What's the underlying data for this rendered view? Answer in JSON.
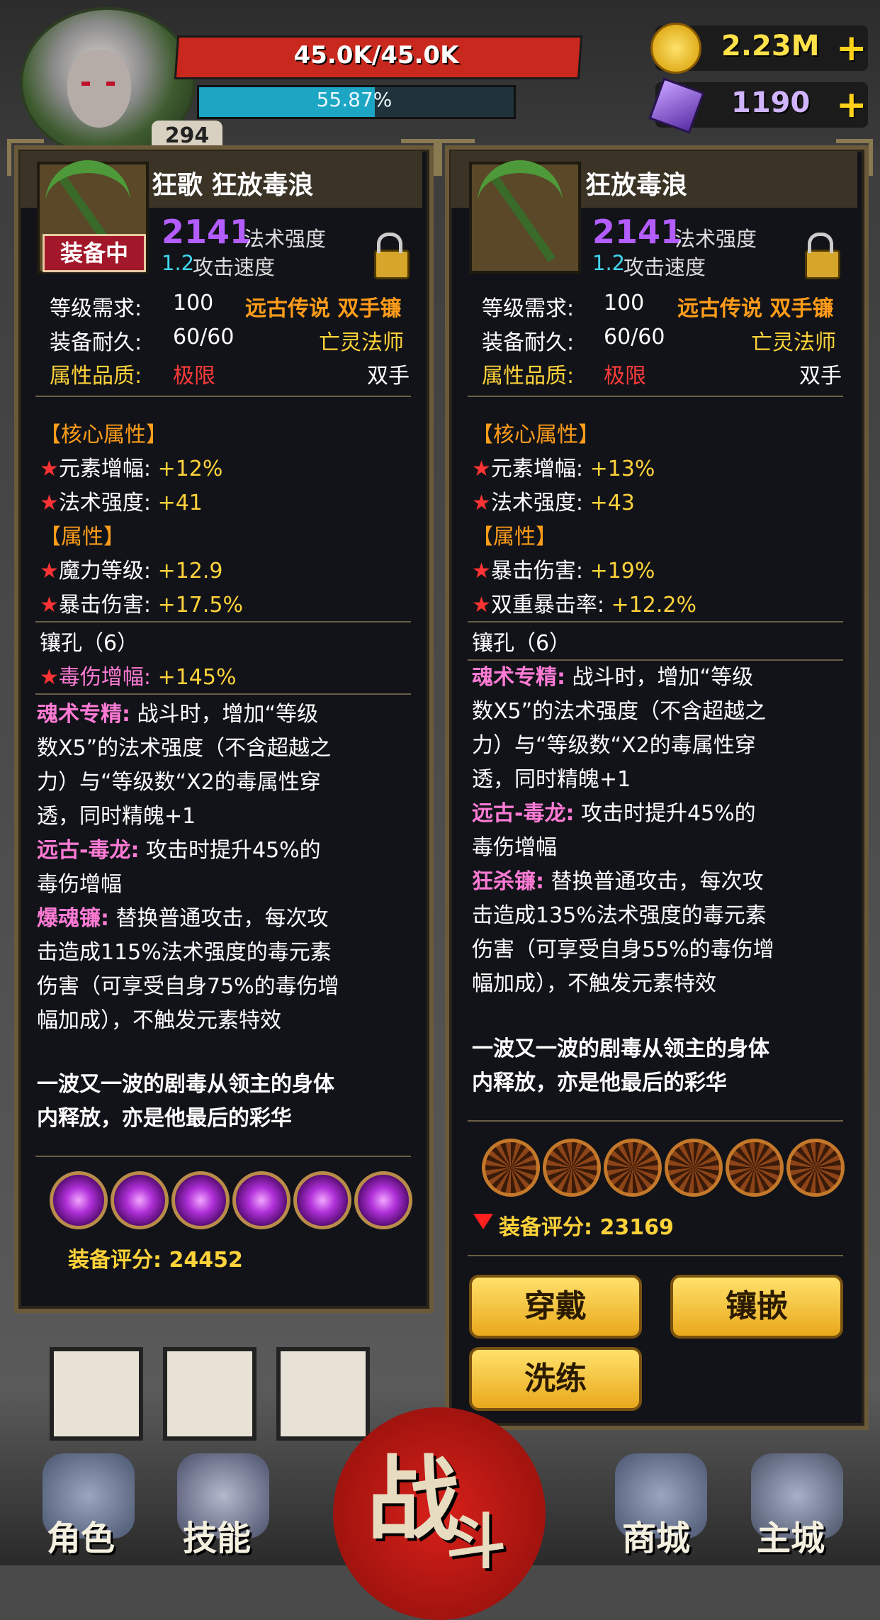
{
  "hud": {
    "hp_text": "45.0K/45.0K",
    "hp_fraction": 1.0,
    "xp_text": "55.87%",
    "xp_fraction": 0.5587,
    "level": "294",
    "gold": "2.23M",
    "gems": "1190",
    "plus": "+"
  },
  "left": {
    "title": "狂歌 狂放毒浪",
    "power": "2141",
    "power_label": "法术强度",
    "speed": "1.2",
    "speed_label": "攻击速度",
    "equipped_badge": "装备中",
    "req_label": "等级需求:",
    "req_value": "100",
    "type": "远古传说 双手镰",
    "dur_label": "装备耐久:",
    "dur_value": "60/60",
    "class": "亡灵法师",
    "quality_label": "属性品质:",
    "quality_value": "极限",
    "hand": "双手",
    "core_section": "【核心属性】",
    "core": [
      {
        "name": "元素增幅:",
        "value": "+12%"
      },
      {
        "name": "法术强度:",
        "value": "+41"
      }
    ],
    "attr_section": "【属性】",
    "attrs": [
      {
        "name": "魔力等级:",
        "value": "+12.9"
      },
      {
        "name": "暴击伤害:",
        "value": "+17.5%"
      }
    ],
    "sockets_label": "镶孔（6）",
    "socket_bonus_name": "毒伤增幅:",
    "socket_bonus_value": "+145%",
    "skill1_name": "魂术专精:",
    "skill1_lines": [
      "战斗时，增加“等级",
      "数X5”的法术强度（不含超越之",
      "力）与“等级数“X2的毒属性穿",
      "透，同时精魄+1"
    ],
    "skill2_name": "远古-毒龙:",
    "skill2_lines": [
      "攻击时提升45%的",
      "毒伤增幅"
    ],
    "skill3_name": "爆魂镰:",
    "skill3_lines": [
      "替换普通攻击，每次攻",
      "击造成115%法术强度的毒元素",
      "伤害（可享受自身75%的毒伤增",
      "幅加成），不触发元素特效"
    ],
    "flavor_lines": [
      "一波又一波的剧毒从领主的身体",
      "内释放，亦是他最后的彩华"
    ],
    "score_label": "装备评分:",
    "score": "24452"
  },
  "right": {
    "title": "狂放毒浪",
    "power": "2141",
    "power_label": "法术强度",
    "speed": "1.2",
    "speed_label": "攻击速度",
    "req_label": "等级需求:",
    "req_value": "100",
    "type": "远古传说 双手镰",
    "dur_label": "装备耐久:",
    "dur_value": "60/60",
    "class": "亡灵法师",
    "quality_label": "属性品质:",
    "quality_value": "极限",
    "hand": "双手",
    "core_section": "【核心属性】",
    "core": [
      {
        "name": "元素增幅:",
        "value": "+13%"
      },
      {
        "name": "法术强度:",
        "value": "+43"
      }
    ],
    "attr_section": "【属性】",
    "attrs": [
      {
        "name": "暴击伤害:",
        "value": "+19%"
      },
      {
        "name": "双重暴击率:",
        "value": "+12.2%"
      }
    ],
    "sockets_label": "镶孔（6）",
    "skill1_name": "魂术专精:",
    "skill1_lines": [
      "战斗时，增加“等级",
      "数X5”的法术强度（不含超越之",
      "力）与“等级数“X2的毒属性穿",
      "透，同时精魄+1"
    ],
    "skill2_name": "远古-毒龙:",
    "skill2_lines": [
      "攻击时提升45%的",
      "毒伤增幅"
    ],
    "skill3_name": "狂杀镰:",
    "skill3_lines": [
      "替换普通攻击，每次攻",
      "击造成135%法术强度的毒元素",
      "伤害（可享受自身55%的毒伤增",
      "幅加成），不触发元素特效"
    ],
    "flavor_lines": [
      "一波又一波的剧毒从领主的身体",
      "内释放，亦是他最后的彩华"
    ],
    "score_label": "装备评分:",
    "score": "23169",
    "buttons": {
      "equip": "穿戴",
      "inlay": "镶嵌",
      "reforge": "洗练"
    }
  },
  "nav": {
    "character": "角色",
    "skills": "技能",
    "fight_1": "战",
    "fight_2": "斗",
    "shop": "商城",
    "main_city": "主城"
  },
  "colors": {
    "hp": "#c8281e",
    "xp": "#1ca6c4",
    "power": "#b35cff",
    "stat_value": "#ffd23a",
    "rarity": "#ff9c1a",
    "quality": "#ff3b3b",
    "skill_name": "#ff7bd5",
    "flavor": "#a899d8"
  }
}
